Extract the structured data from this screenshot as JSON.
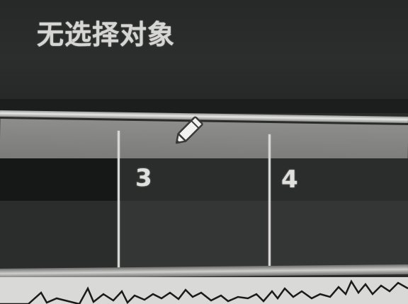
{
  "status": {
    "no_selection": "无选择对象"
  },
  "timeline": {
    "markers": [
      {
        "label": "3"
      },
      {
        "label": "4"
      }
    ]
  },
  "cursor": {
    "icon": "pencil-icon"
  },
  "colors": {
    "panel_bg": "#2a2b2b",
    "text": "#d6d6d4",
    "ruler": "#8d8d8c",
    "bar_row": "#1d1e1e",
    "track": "#343535",
    "waveform_bg": "#d9d9d7",
    "waveform": "#1a1a1a"
  }
}
